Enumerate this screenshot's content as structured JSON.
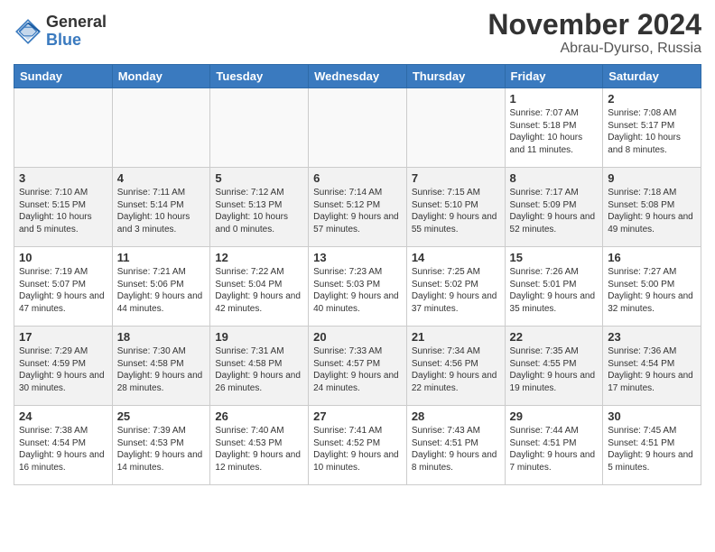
{
  "logo": {
    "general": "General",
    "blue": "Blue"
  },
  "header": {
    "month": "November 2024",
    "location": "Abrau-Dyurso, Russia"
  },
  "weekdays": [
    "Sunday",
    "Monday",
    "Tuesday",
    "Wednesday",
    "Thursday",
    "Friday",
    "Saturday"
  ],
  "weeks": [
    [
      {
        "day": "",
        "info": ""
      },
      {
        "day": "",
        "info": ""
      },
      {
        "day": "",
        "info": ""
      },
      {
        "day": "",
        "info": ""
      },
      {
        "day": "",
        "info": ""
      },
      {
        "day": "1",
        "info": "Sunrise: 7:07 AM\nSunset: 5:18 PM\nDaylight: 10 hours and 11 minutes."
      },
      {
        "day": "2",
        "info": "Sunrise: 7:08 AM\nSunset: 5:17 PM\nDaylight: 10 hours and 8 minutes."
      }
    ],
    [
      {
        "day": "3",
        "info": "Sunrise: 7:10 AM\nSunset: 5:15 PM\nDaylight: 10 hours and 5 minutes."
      },
      {
        "day": "4",
        "info": "Sunrise: 7:11 AM\nSunset: 5:14 PM\nDaylight: 10 hours and 3 minutes."
      },
      {
        "day": "5",
        "info": "Sunrise: 7:12 AM\nSunset: 5:13 PM\nDaylight: 10 hours and 0 minutes."
      },
      {
        "day": "6",
        "info": "Sunrise: 7:14 AM\nSunset: 5:12 PM\nDaylight: 9 hours and 57 minutes."
      },
      {
        "day": "7",
        "info": "Sunrise: 7:15 AM\nSunset: 5:10 PM\nDaylight: 9 hours and 55 minutes."
      },
      {
        "day": "8",
        "info": "Sunrise: 7:17 AM\nSunset: 5:09 PM\nDaylight: 9 hours and 52 minutes."
      },
      {
        "day": "9",
        "info": "Sunrise: 7:18 AM\nSunset: 5:08 PM\nDaylight: 9 hours and 49 minutes."
      }
    ],
    [
      {
        "day": "10",
        "info": "Sunrise: 7:19 AM\nSunset: 5:07 PM\nDaylight: 9 hours and 47 minutes."
      },
      {
        "day": "11",
        "info": "Sunrise: 7:21 AM\nSunset: 5:06 PM\nDaylight: 9 hours and 44 minutes."
      },
      {
        "day": "12",
        "info": "Sunrise: 7:22 AM\nSunset: 5:04 PM\nDaylight: 9 hours and 42 minutes."
      },
      {
        "day": "13",
        "info": "Sunrise: 7:23 AM\nSunset: 5:03 PM\nDaylight: 9 hours and 40 minutes."
      },
      {
        "day": "14",
        "info": "Sunrise: 7:25 AM\nSunset: 5:02 PM\nDaylight: 9 hours and 37 minutes."
      },
      {
        "day": "15",
        "info": "Sunrise: 7:26 AM\nSunset: 5:01 PM\nDaylight: 9 hours and 35 minutes."
      },
      {
        "day": "16",
        "info": "Sunrise: 7:27 AM\nSunset: 5:00 PM\nDaylight: 9 hours and 32 minutes."
      }
    ],
    [
      {
        "day": "17",
        "info": "Sunrise: 7:29 AM\nSunset: 4:59 PM\nDaylight: 9 hours and 30 minutes."
      },
      {
        "day": "18",
        "info": "Sunrise: 7:30 AM\nSunset: 4:58 PM\nDaylight: 9 hours and 28 minutes."
      },
      {
        "day": "19",
        "info": "Sunrise: 7:31 AM\nSunset: 4:58 PM\nDaylight: 9 hours and 26 minutes."
      },
      {
        "day": "20",
        "info": "Sunrise: 7:33 AM\nSunset: 4:57 PM\nDaylight: 9 hours and 24 minutes."
      },
      {
        "day": "21",
        "info": "Sunrise: 7:34 AM\nSunset: 4:56 PM\nDaylight: 9 hours and 22 minutes."
      },
      {
        "day": "22",
        "info": "Sunrise: 7:35 AM\nSunset: 4:55 PM\nDaylight: 9 hours and 19 minutes."
      },
      {
        "day": "23",
        "info": "Sunrise: 7:36 AM\nSunset: 4:54 PM\nDaylight: 9 hours and 17 minutes."
      }
    ],
    [
      {
        "day": "24",
        "info": "Sunrise: 7:38 AM\nSunset: 4:54 PM\nDaylight: 9 hours and 16 minutes."
      },
      {
        "day": "25",
        "info": "Sunrise: 7:39 AM\nSunset: 4:53 PM\nDaylight: 9 hours and 14 minutes."
      },
      {
        "day": "26",
        "info": "Sunrise: 7:40 AM\nSunset: 4:53 PM\nDaylight: 9 hours and 12 minutes."
      },
      {
        "day": "27",
        "info": "Sunrise: 7:41 AM\nSunset: 4:52 PM\nDaylight: 9 hours and 10 minutes."
      },
      {
        "day": "28",
        "info": "Sunrise: 7:43 AM\nSunset: 4:51 PM\nDaylight: 9 hours and 8 minutes."
      },
      {
        "day": "29",
        "info": "Sunrise: 7:44 AM\nSunset: 4:51 PM\nDaylight: 9 hours and 7 minutes."
      },
      {
        "day": "30",
        "info": "Sunrise: 7:45 AM\nSunset: 4:51 PM\nDaylight: 9 hours and 5 minutes."
      }
    ]
  ]
}
